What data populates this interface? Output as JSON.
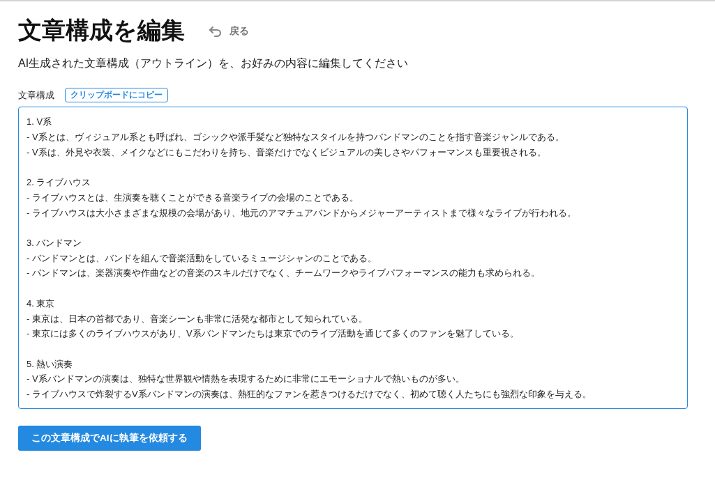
{
  "page": {
    "title": "文章構成を編集",
    "back_link": "戻る",
    "description": "AI生成された文章構成（アウトライン）を、お好みの内容に編集してください"
  },
  "outline": {
    "label": "文章構成",
    "copy_button": "クリップボードにコピー",
    "value": "1. V系\n- V系とは、ヴィジュアル系とも呼ばれ、ゴシックや派手髪など独特なスタイルを持つバンドマンのことを指す音楽ジャンルである。\n- V系は、外見や衣装、メイクなどにもこだわりを持ち、音楽だけでなくビジュアルの美しさやパフォーマンスも重要視される。\n\n2. ライブハウス\n- ライブハウスとは、生演奏を聴くことができる音楽ライブの会場のことである。\n- ライブハウスは大小さまざまな規模の会場があり、地元のアマチュアバンドからメジャーアーティストまで様々なライブが行われる。\n\n3. バンドマン\n- バンドマンとは、バンドを組んで音楽活動をしているミュージシャンのことである。\n- バンドマンは、楽器演奏や作曲などの音楽のスキルだけでなく、チームワークやライブパフォーマンスの能力も求められる。\n\n4. 東京\n- 東京は、日本の首都であり、音楽シーンも非常に活発な都市として知られている。\n- 東京には多くのライブハウスがあり、V系バンドマンたちは東京でのライブ活動を通じて多くのファンを魅了している。\n\n5. 熱い演奏\n- V系バンドマンの演奏は、独特な世界観や情熱を表現するために非常にエモーショナルで熱いものが多い。\n- ライブハウスで炸裂するV系バンドマンの演奏は、熱狂的なファンを惹きつけるだけでなく、初めて聴く人たちにも強烈な印象を与える。"
  },
  "submit_button": "この文章構成でAIに執筆を依頼する"
}
